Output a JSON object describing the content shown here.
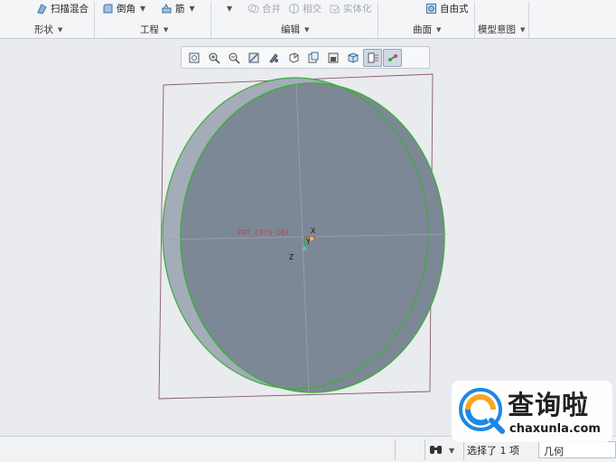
{
  "ribbon": {
    "row1": {
      "sweep_blend": "扫描混合",
      "round": "倒角",
      "rib": "筋",
      "merge": "合并",
      "intersect": "相交",
      "solidify": "实体化",
      "freestyle": "自由式"
    },
    "groups": {
      "shapes": "形状",
      "engineering": "工程",
      "editing": "编辑",
      "surfaces": "曲面",
      "model_intent": "模型意图"
    }
  },
  "view_toolbar": {
    "buttons": [
      "refit-icon",
      "zoom-in-icon",
      "zoom-out-icon",
      "repaint-icon",
      "reorient-icon",
      "saved-orientations-icon",
      "display-style-icon",
      "perspective-icon",
      "view-manager-icon",
      "datum-display-icon",
      "spin-center-icon"
    ],
    "active_buttons": [
      "datum-display-icon",
      "spin-center-icon"
    ]
  },
  "viewport": {
    "csys_label": "PRT_CSYS_DEF",
    "axis_x": "X",
    "axis_y": "Y",
    "axis_z": "Z",
    "colors": {
      "background": "#e9ebee",
      "disc_face": "#7d8896",
      "disc_side": "#a3acb8",
      "edge_highlight": "#3cae3c",
      "datum_plane": "#8a5a68",
      "csys": "#c0504d"
    }
  },
  "statusbar": {
    "selection": "选择了 1 项",
    "filter_value": "几何"
  },
  "watermark": {
    "text": "查询啦",
    "url": "chaxunla.com"
  }
}
